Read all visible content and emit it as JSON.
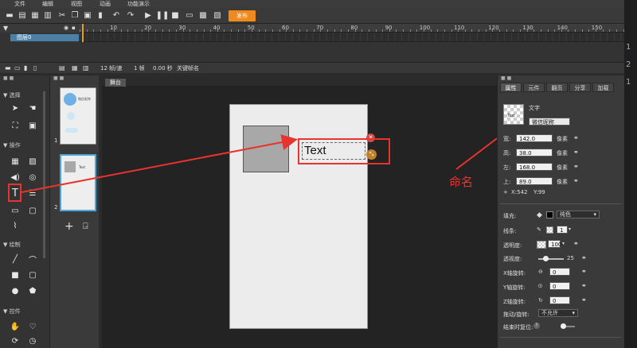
{
  "menu": [
    "文件",
    "编辑",
    "视图",
    "动画",
    "功能演示"
  ],
  "toolbar": {
    "publish_label": "发布"
  },
  "timeline": {
    "layer_name": "图层0",
    "ruler_ticks": [
      "10",
      "20",
      "30",
      "40",
      "50",
      "60",
      "70",
      "80",
      "90",
      "100",
      "110",
      "120",
      "130",
      "140",
      "150"
    ],
    "status": {
      "fps": "12 帧/速",
      "frame": "1 帧",
      "time": "0.00 秒",
      "keyframe": "关键帧名"
    }
  },
  "gutter_numbers": [
    "1",
    "2",
    "1"
  ],
  "tools": {
    "sections": {
      "select": "选择",
      "operate": "操作",
      "draw": "绘制",
      "control": "控件"
    }
  },
  "pages": {
    "items": [
      {
        "number": "1",
        "caption": "微信昵称"
      },
      {
        "number": "2",
        "caption": "Text"
      }
    ]
  },
  "stage": {
    "tab_label": "舞台",
    "text_object": "Text"
  },
  "annotation": {
    "label": "命名"
  },
  "properties": {
    "tabs": [
      "属性",
      "元件",
      "翻页",
      "分享",
      "加载"
    ],
    "element_type": "文字",
    "thumb_text": "Text",
    "name_value": "微信昵称",
    "width_label": "宽:",
    "width_value": "142.0",
    "height_label": "高:",
    "height_value": "38.0",
    "left_label": "左:",
    "left_value": "168.0",
    "top_label": "上:",
    "top_value": "89.0",
    "unit": "像素",
    "coord_x": "X:542",
    "coord_y": "Y:99",
    "fill_label": "填充:",
    "fill_mode": "纯色",
    "stroke_label": "线条:",
    "stroke_value": "1",
    "opacity_label": "透明度:",
    "opacity_value": "100",
    "perspective_label": "透视度:",
    "perspective_value": "25",
    "x_rot_label": "X轴旋转:",
    "x_rot_value": "0",
    "y_rot_label": "Y轴旋转:",
    "y_rot_value": "0",
    "z_rot_label": "Z轴旋转:",
    "z_rot_value": "0",
    "drag_label": "拖动/旋转:",
    "drag_value": "不允许",
    "reset_label": "结束时复位:"
  },
  "colors": {
    "accent": "#f08a1c",
    "annotation": "#e8332e",
    "selection": "#4ea6d8"
  }
}
